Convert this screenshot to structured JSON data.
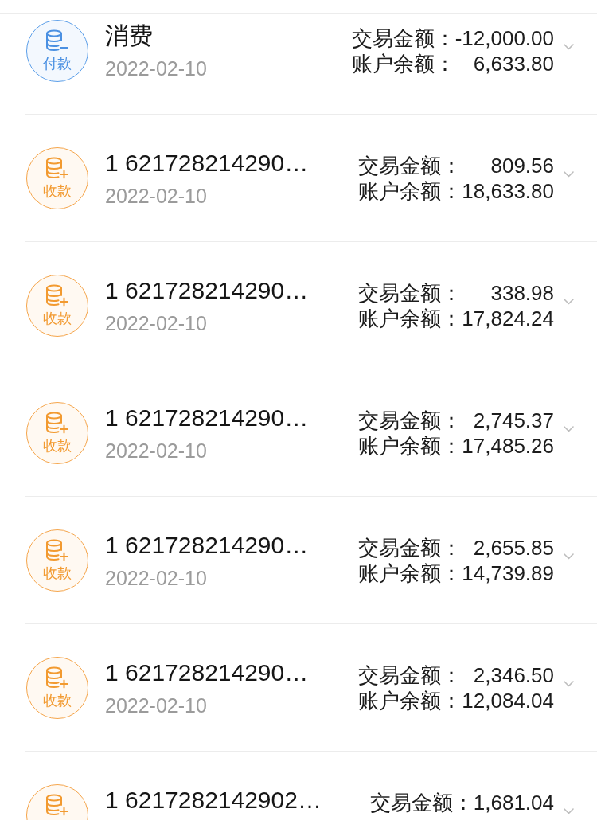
{
  "transactions": [
    {
      "kind": "payment",
      "icon_label": "付款",
      "title": "消费",
      "date": "2022-02-10",
      "amount_label": "交易金额：",
      "amount": "-12,000.00",
      "balance_label": "账户余额：",
      "balance": "6,633.80"
    },
    {
      "kind": "receipt",
      "icon_label": "收款",
      "title": "1 621728214290…",
      "date": "2022-02-10",
      "amount_label": "交易金额：",
      "amount": "809.56",
      "balance_label": "账户余额：",
      "balance": "18,633.80"
    },
    {
      "kind": "receipt",
      "icon_label": "收款",
      "title": "1 621728214290…",
      "date": "2022-02-10",
      "amount_label": "交易金额：",
      "amount": "338.98",
      "balance_label": "账户余额：",
      "balance": "17,824.24"
    },
    {
      "kind": "receipt",
      "icon_label": "收款",
      "title": "1 621728214290…",
      "date": "2022-02-10",
      "amount_label": "交易金额：",
      "amount": "2,745.37",
      "balance_label": "账户余额：",
      "balance": "17,485.26"
    },
    {
      "kind": "receipt",
      "icon_label": "收款",
      "title": "1 621728214290…",
      "date": "2022-02-10",
      "amount_label": "交易金额：",
      "amount": "2,655.85",
      "balance_label": "账户余额：",
      "balance": "14,739.89"
    },
    {
      "kind": "receipt",
      "icon_label": "收款",
      "title": "1 621728214290…",
      "date": "2022-02-10",
      "amount_label": "交易金额：",
      "amount": "2,346.50",
      "balance_label": "账户余额：",
      "balance": "12,084.04"
    },
    {
      "kind": "receipt",
      "title": "1 6217282142902…",
      "amount_label": "交易金额：",
      "amount": "1,681.04"
    }
  ]
}
